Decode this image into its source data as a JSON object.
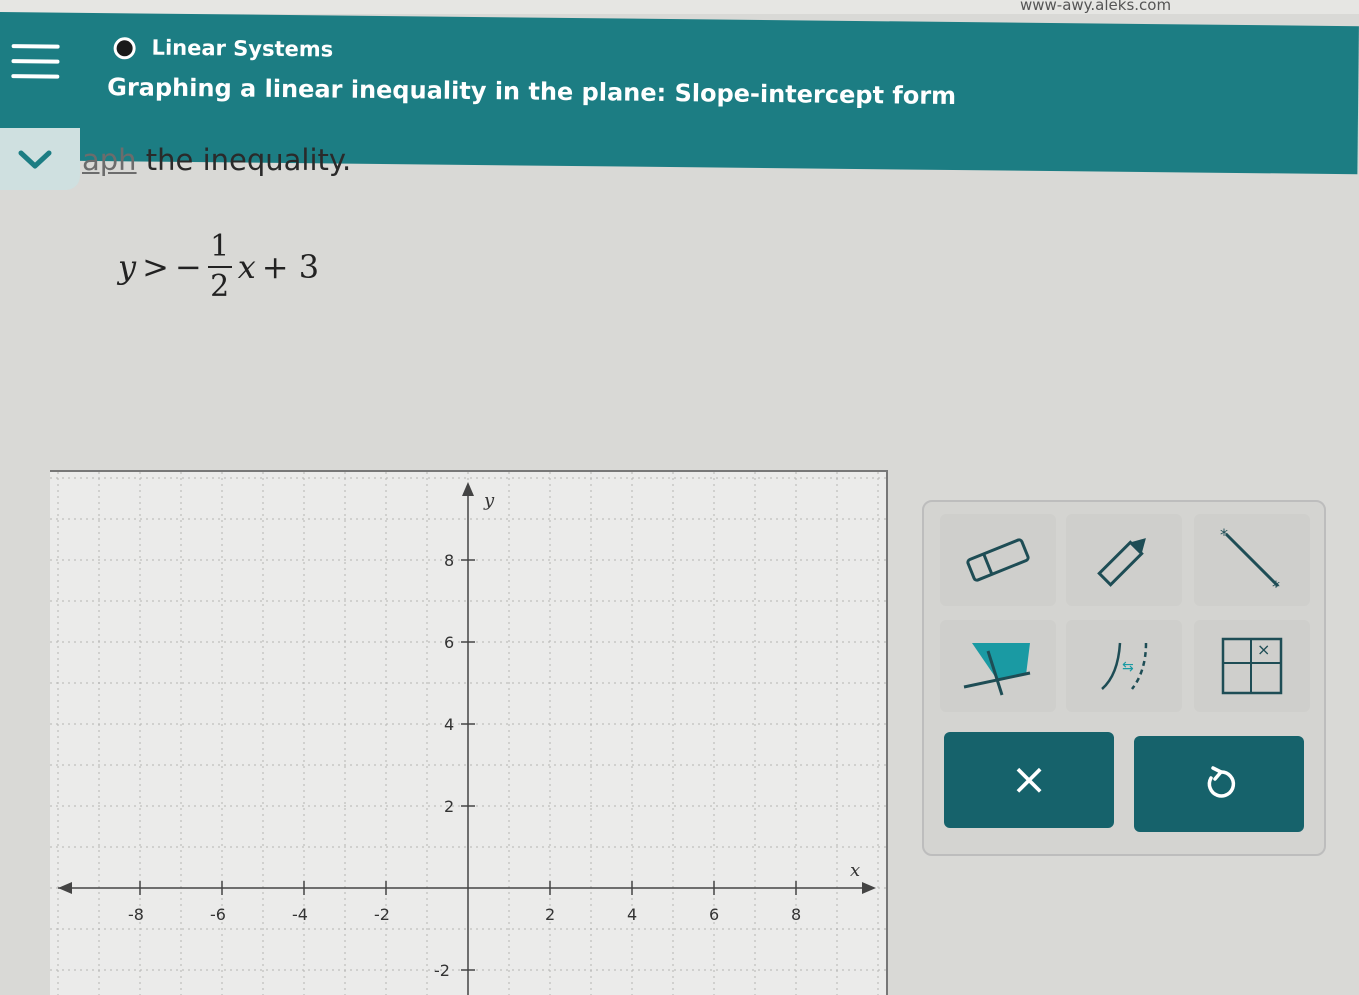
{
  "browser": {
    "url_text": "www-awy.aleks.com"
  },
  "header": {
    "topic": "Linear Systems",
    "lesson_title": "Graphing a linear inequality in the plane: Slope-intercept form"
  },
  "problem": {
    "instruction_prefix": "aph",
    "instruction_rest": " the inequality.",
    "equation": {
      "lhs": "y",
      "relation": ">",
      "sign": "−",
      "numerator": "1",
      "denominator": "2",
      "var": "x",
      "constant_term": "+ 3"
    }
  },
  "graph": {
    "x_axis_label": "x",
    "y_axis_label": "y",
    "x_ticks": [
      "-8",
      "-6",
      "-4",
      "-2",
      "2",
      "4",
      "6",
      "8"
    ],
    "y_ticks": [
      "8",
      "6",
      "4",
      "2",
      "-2"
    ]
  },
  "tools": {
    "items": [
      "eraser-icon",
      "pencil-icon",
      "line-icon",
      "fill-region-icon",
      "solid-dashed-toggle-icon",
      "no-solution-icon"
    ],
    "clear_button_glyph": "×",
    "undo_button_glyph": "undo-icon"
  },
  "colors": {
    "header": "#1c7d83",
    "accent": "#1a9aa3",
    "button": "#16626b"
  }
}
